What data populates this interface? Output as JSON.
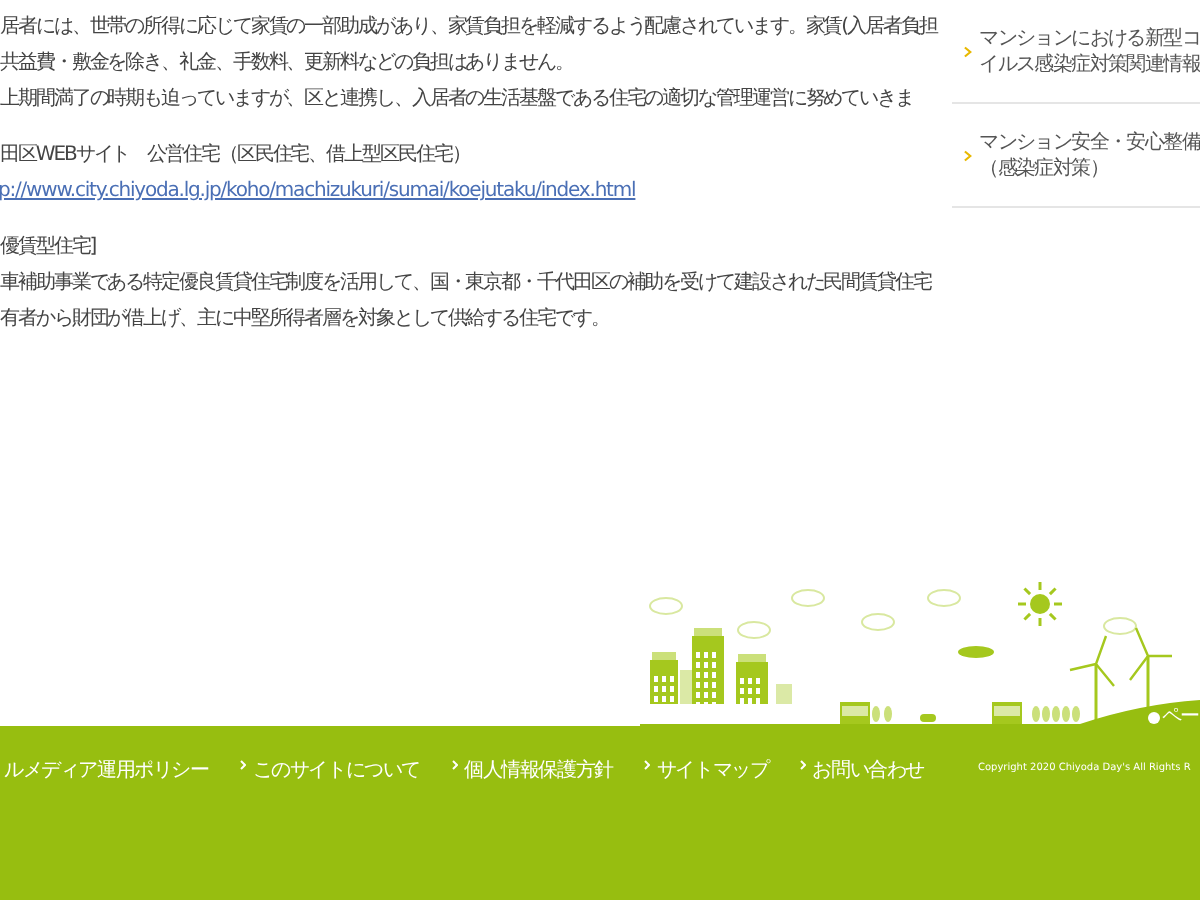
{
  "article": {
    "paragraphs": [
      {
        "kind": "text",
        "text": "居者には、世帯の所得に応じて家賃の一部助成があり、家賃負担を軽減するよう配慮されています。家賃(入居者負担"
      },
      {
        "kind": "text",
        "text": "共益費・敷金を除き、礼金、手数料、更新料などの負担はありません。"
      },
      {
        "kind": "text",
        "text": "上期間満了の時期も迫っていますが、区と連携し、入居者の生活基盤である住宅の適切な管理運営に努めていきま"
      },
      {
        "kind": "gap"
      },
      {
        "kind": "text",
        "text": "田区WEBサイト　公営住宅（区民住宅、借上型区民住宅）"
      },
      {
        "kind": "link",
        "text": "p://www.city.chiyoda.lg.jp/koho/machizukuri/sumai/koejutaku/index.html"
      },
      {
        "kind": "gap"
      },
      {
        "kind": "text",
        "text": "優賃型住宅]"
      },
      {
        "kind": "text",
        "text": "車補助事業である特定優良賃貸住宅制度を活用して、国・東京都・千代田区の補助を受けて建設された民間賃貸住宅"
      },
      {
        "kind": "text",
        "text": "有者から財団が借上げ、主に中堅所得者層を対象として供給する住宅です。"
      }
    ]
  },
  "sidebar": {
    "items": [
      {
        "lines": [
          "マンションにおける新型コ",
          "イルス感染症対策関連情報"
        ]
      },
      {
        "lines": [
          "マンション安全・安心整備",
          "（感染症対策）"
        ]
      }
    ]
  },
  "page_top": {
    "label": "ペー"
  },
  "footer": {
    "links": [
      "ルメディア運用ポリシー",
      "このサイトについて",
      "個人情報保護方針",
      "サイトマップ",
      "お問い合わせ"
    ],
    "copyright": "Copyright 2020 Chiyoda Day's All Rights R"
  }
}
